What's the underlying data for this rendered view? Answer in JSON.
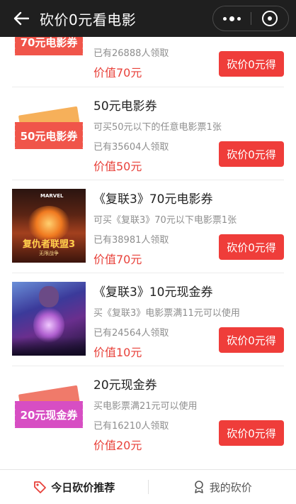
{
  "header": {
    "title": "砍价0元看电影"
  },
  "items": [
    {
      "ticket_text": "70元电影券",
      "claimed": "已有26888人领取",
      "value": "价值70元",
      "button": "砍价0元得"
    },
    {
      "ticket_text": "50元电影券",
      "name": "50元电影券",
      "desc": "可买50元以下的任意电影票1张",
      "claimed": "已有35604人领取",
      "value": "价值50元",
      "button": "砍价0元得"
    },
    {
      "poster_logo": "MARVEL",
      "poster_title": "复仇者联盟3",
      "poster_sub": "无限战争",
      "name": "《复联3》70元电影券",
      "desc": "可买《复联3》70元以下电影票1张",
      "claimed": "已有38981人领取",
      "value": "价值70元",
      "button": "砍价0元得"
    },
    {
      "name": "《复联3》10元现金券",
      "desc": "买《复联3》电影票满11元可以使用",
      "claimed": "已有24564人领取",
      "value": "价值10元",
      "button": "砍价0元得"
    },
    {
      "ticket_text": "20元现金券",
      "name": "20元现金券",
      "desc": "买电影票满21元可以使用",
      "claimed": "已有16210人领取",
      "value": "价值20元",
      "button": "砍价0元得"
    }
  ],
  "tabs": [
    {
      "label": "今日砍价推荐",
      "icon": "tag-icon"
    },
    {
      "label": "我的砍价",
      "icon": "user-icon"
    }
  ],
  "colors": {
    "accent": "#ef3d3a",
    "price": "#e8413a",
    "topbar": "#1f1f1f",
    "ticket_red": "#f0554a",
    "ticket_orange": "#f4a040",
    "ticket_pink": "#d74ec3"
  }
}
